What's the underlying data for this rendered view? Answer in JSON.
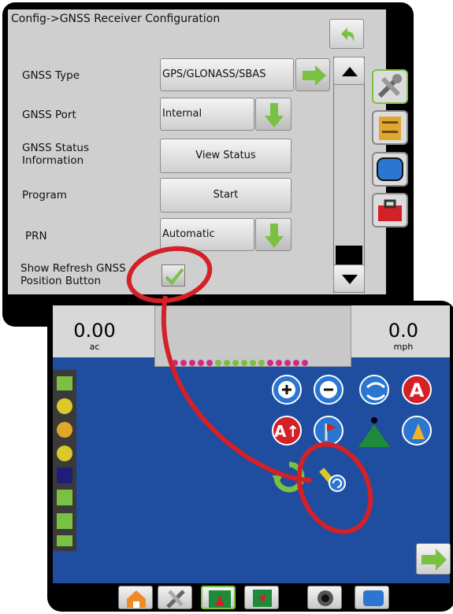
{
  "config": {
    "title": "Config->GNSS Receiver Configuration",
    "rows": [
      {
        "label": "GNSS Type",
        "value": "GPS/GLONASS/SBAS"
      },
      {
        "label": "GNSS Port",
        "value": "Internal"
      },
      {
        "label": "GNSS Status Information",
        "value": "View Status"
      },
      {
        "label": "Program",
        "value": "Start"
      },
      {
        "label": "PRN",
        "value": "Automatic"
      },
      {
        "label": "Show Refresh GNSS Position Button",
        "value": "checked"
      }
    ]
  },
  "map": {
    "area_value": "0.00",
    "area_unit": "ac",
    "speed_value": "0.0",
    "speed_unit": "mph"
  },
  "colors": {
    "accent_green": "#7ac143",
    "highlight_red": "#d42027",
    "map_blue": "#1f4da0"
  }
}
